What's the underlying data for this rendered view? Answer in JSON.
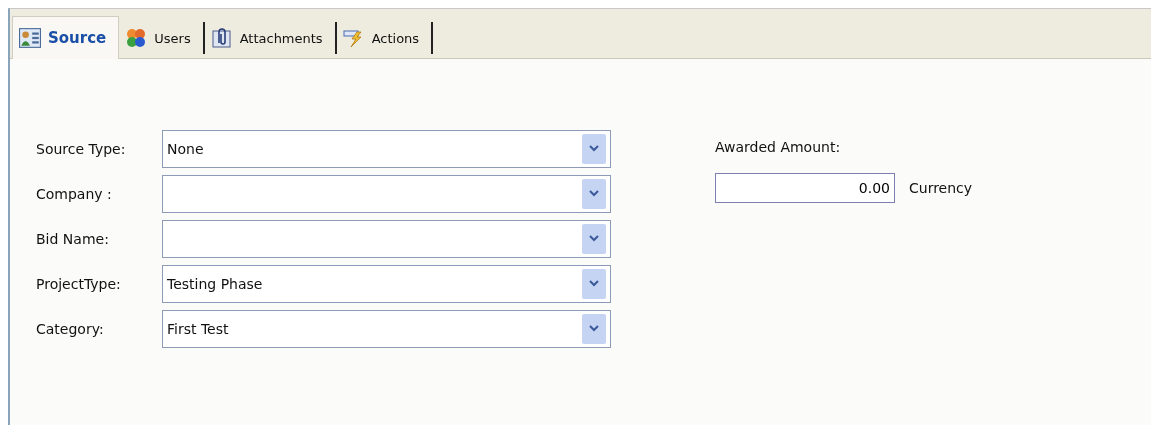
{
  "tabs": [
    {
      "label": "Source",
      "selected": true,
      "kind": "contact"
    },
    {
      "label": "Users",
      "selected": false,
      "kind": "users"
    },
    {
      "label": "Attachments",
      "selected": false,
      "kind": "clip"
    },
    {
      "label": "Actions",
      "selected": false,
      "kind": "bolt"
    }
  ],
  "fields": [
    {
      "label": "Source Type:",
      "value": "None"
    },
    {
      "label": "Company :"
    },
    {
      "label": "Bid Name:"
    },
    {
      "label": "ProjectType:",
      "value": "Testing Phase"
    },
    {
      "label": "Category:",
      "value": "First Test"
    }
  ],
  "awarded": {
    "label": "Awarded Amount:",
    "value": "0.00",
    "unit": "Currency"
  }
}
